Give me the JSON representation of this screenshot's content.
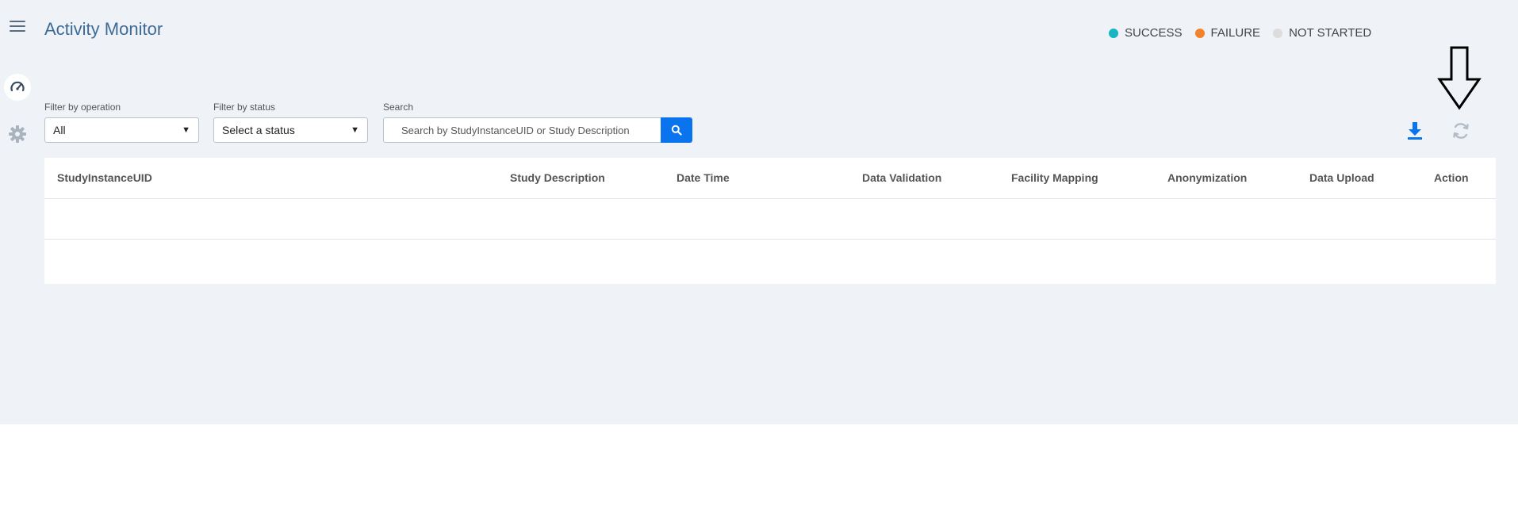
{
  "header": {
    "title": "Activity Monitor"
  },
  "legend": [
    {
      "label": "SUCCESS",
      "color": "#19b5c4"
    },
    {
      "label": "FAILURE",
      "color": "#f5822a"
    },
    {
      "label": "NOT STARTED",
      "color": "#dcdcdc"
    }
  ],
  "sidebar": {
    "items": [
      {
        "name": "menu-icon"
      },
      {
        "name": "dashboard-icon",
        "active": true
      },
      {
        "name": "gear-icon"
      }
    ]
  },
  "filters": {
    "operation": {
      "label": "Filter by operation",
      "value": "All"
    },
    "status": {
      "label": "Filter by status",
      "value": "Select a status"
    },
    "search": {
      "label": "Search",
      "placeholder": "Search by StudyInstanceUID or Study Description"
    }
  },
  "table": {
    "columns": [
      "StudyInstanceUID",
      "Study Description",
      "Date Time",
      "Data Validation",
      "Facility Mapping",
      "Anonymization",
      "Data Upload",
      "Action"
    ],
    "rows": []
  },
  "colors": {
    "accent": "#0a74ee",
    "title": "#3d6b96",
    "background": "#eff3f7"
  }
}
